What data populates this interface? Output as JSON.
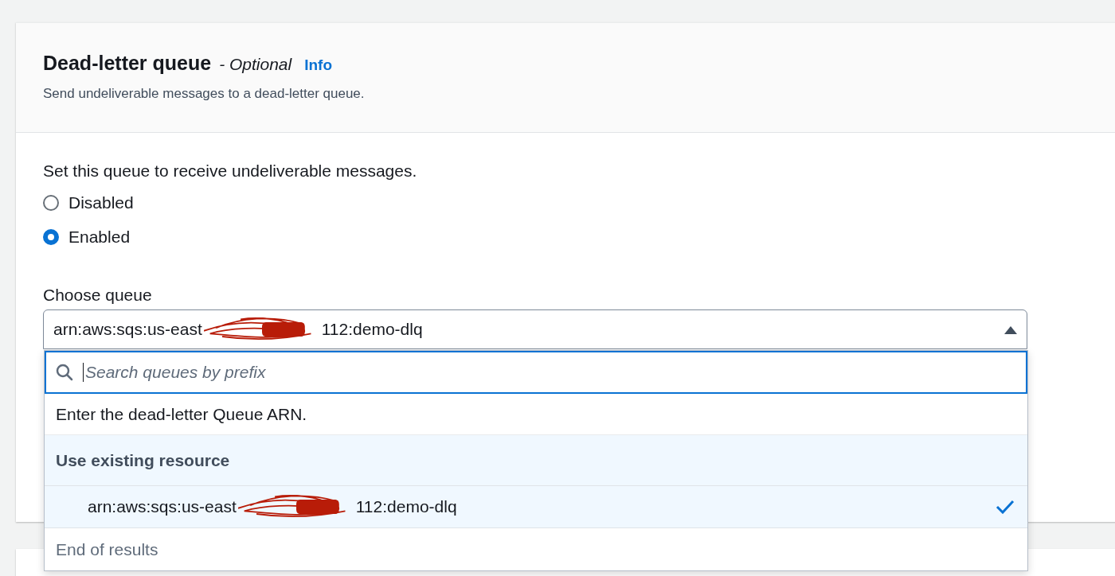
{
  "section": {
    "title": "Dead-letter queue",
    "optional": "- Optional",
    "info": "Info",
    "description": "Send undeliverable messages to a dead-letter queue."
  },
  "radio_group": {
    "label": "Set this queue to receive undeliverable messages.",
    "options": [
      {
        "label": "Disabled",
        "selected": false
      },
      {
        "label": "Enabled",
        "selected": true
      }
    ]
  },
  "queue_select": {
    "label": "Choose queue",
    "value": {
      "prefix": "arn:aws:sqs:us-east",
      "suffix": "112:demo-dlq",
      "redacted": true
    },
    "expanded": true,
    "dropdown": {
      "search": {
        "placeholder": "Search queues by prefix"
      },
      "hint": "Enter the dead-letter Queue ARN.",
      "groups": [
        {
          "label": "Use existing resource",
          "options": [
            {
              "prefix": "arn:aws:sqs:us-east",
              "suffix": "112:demo-dlq",
              "redacted": true,
              "selected": true
            }
          ]
        }
      ],
      "footer": "End of results"
    }
  }
}
